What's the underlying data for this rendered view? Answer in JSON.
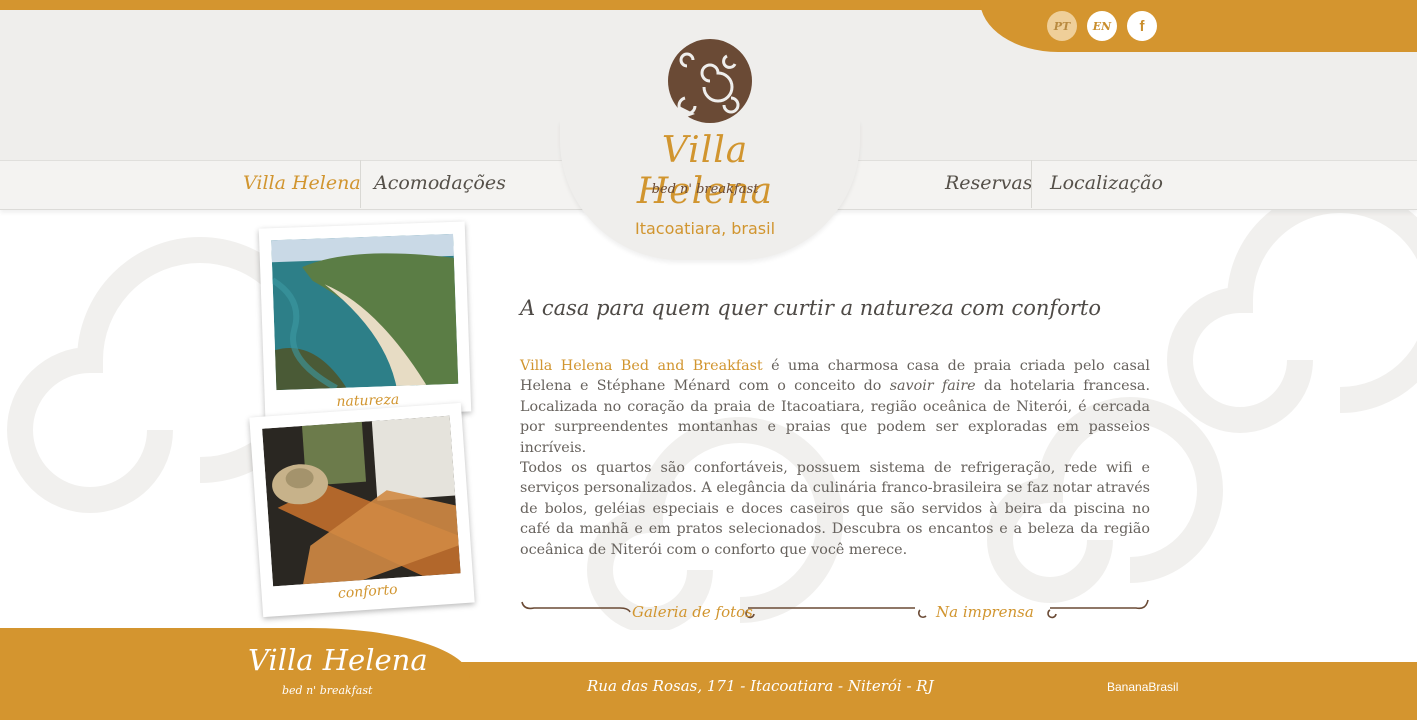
{
  "header": {
    "languages": [
      "PT",
      "EN"
    ],
    "social_icon": "facebook-icon",
    "social_label": "f",
    "nav_left": [
      "Villa Helena",
      "Acomodações"
    ],
    "nav_right": [
      "Reservas",
      "Localização"
    ],
    "active_nav": "Villa Helena"
  },
  "brand": {
    "name": "Villa Helena",
    "tagline": "bed n' breakfast",
    "location": "Itacoatiara, brasil",
    "logo_icon": "swirl-logo-icon"
  },
  "photos": [
    {
      "caption": "natureza",
      "subject": "coastal-beach-photo"
    },
    {
      "caption": "conforto",
      "subject": "hammock-chairs-photo"
    }
  ],
  "content": {
    "headline": "A casa para quem quer curtir a natureza com conforto",
    "para1_highlight": "Villa Helena Bed and Breakfast",
    "para1_a": " é uma charmosa casa de praia criada pelo casal Helena e Stéphane Ménard com o conceito do ",
    "para1_em": "savoir faire",
    "para1_b": " da hotelaria francesa. Localizada no coração da praia de Itacoatiara, região oceânica de Niterói, é cercada por surpreendentes montanhas e praias que podem ser exploradas em passeios incríveis.",
    "para2": "Todos os quartos são confortáveis, possuem sistema de refrigeração, rede wifi e serviços personalizados. A elegância da culinária franco-brasileira se faz notar através de bolos, geléias especiais e doces caseiros que são servidos à beira da piscina no café da manhã e em pratos selecionados. Descubra os encantos e a beleza da região oceânica de Niterói com o conforto que você merece.",
    "link_gallery": "Galeria de fotos",
    "link_press": "Na imprensa"
  },
  "footer": {
    "brand": "Villa Helena",
    "tagline": "bed n' breakfast",
    "address": "Rua das Rosas, 171 - Itacoatiara - Niterói - RJ",
    "credit": "BananaBrasil"
  },
  "colors": {
    "accent": "#d4952f",
    "text": "#67625d",
    "header_bg": "#efeeec"
  }
}
